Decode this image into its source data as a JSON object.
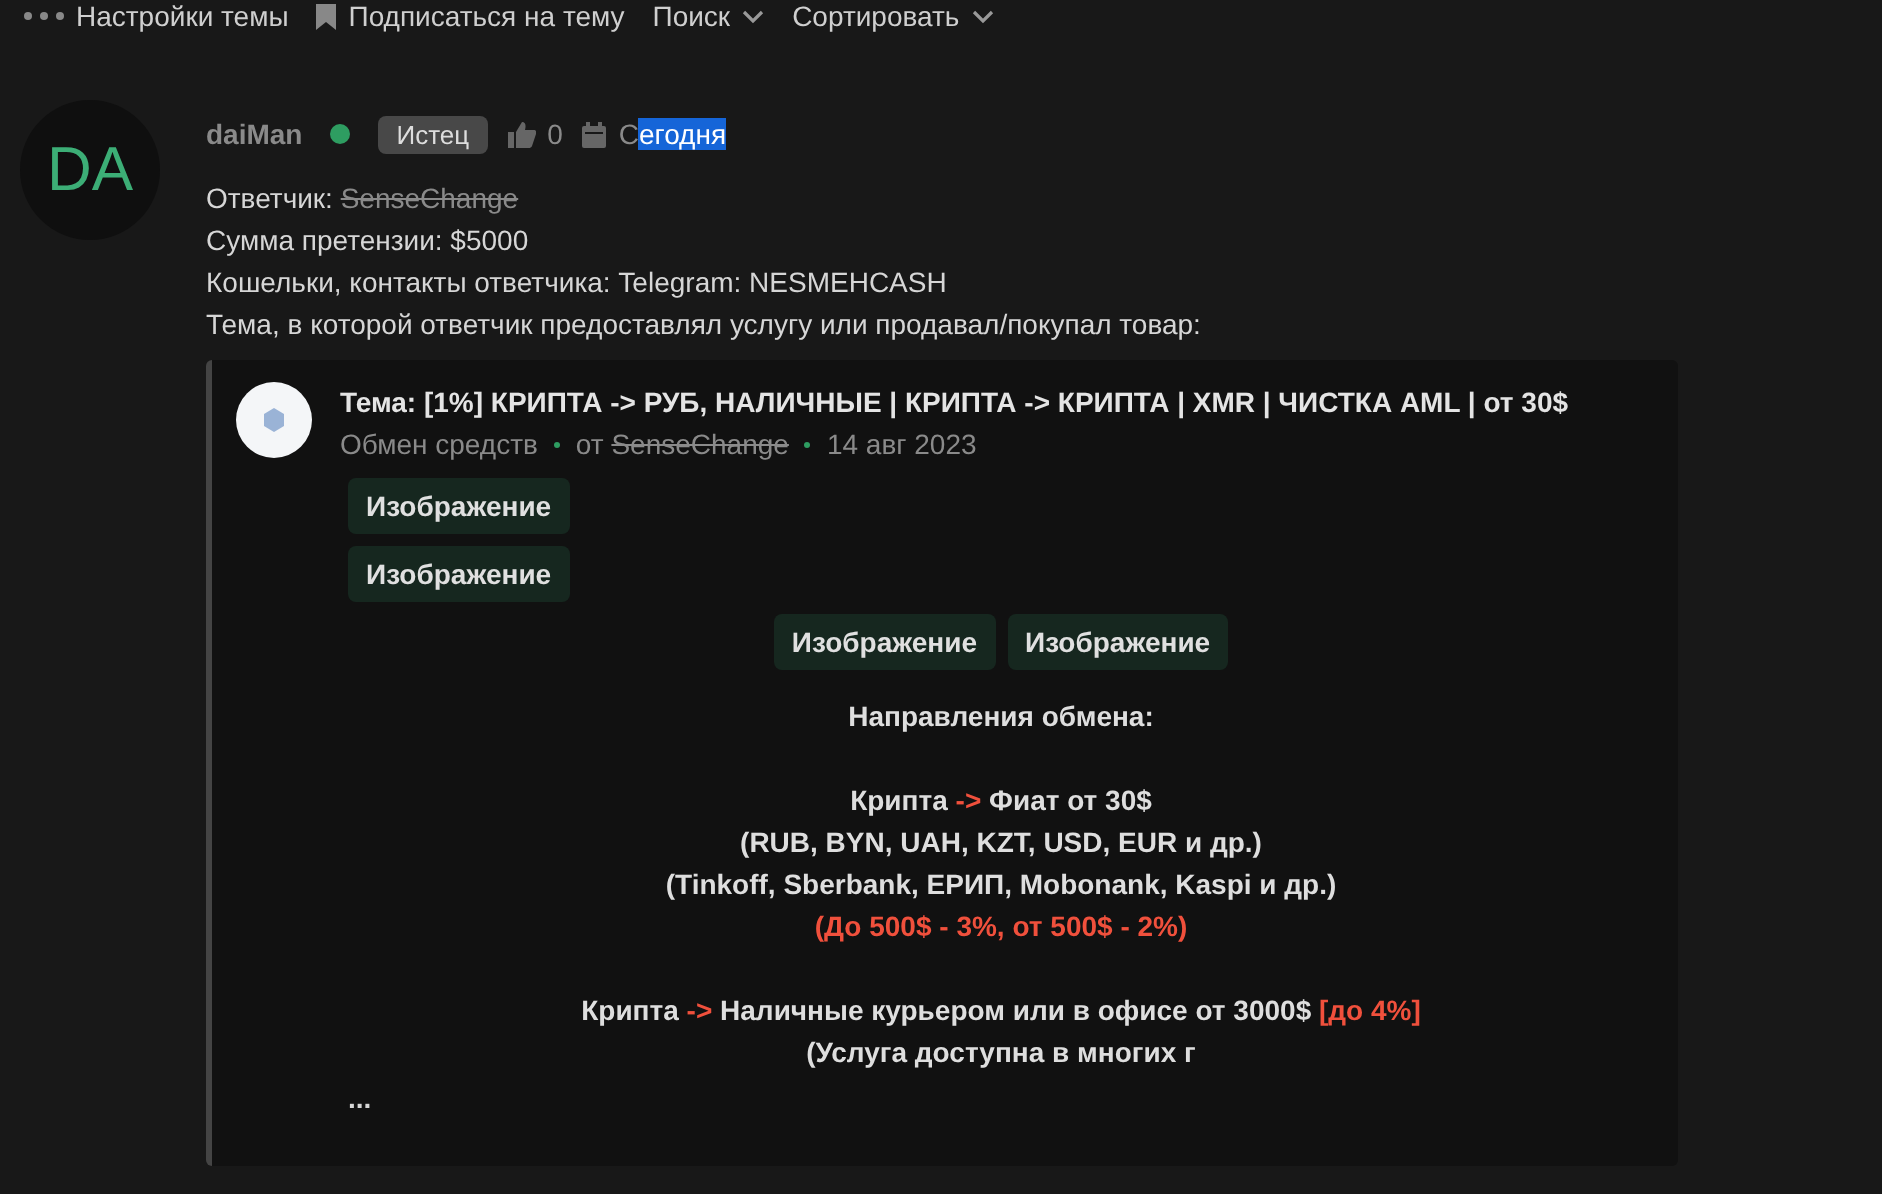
{
  "toolbar": {
    "items": [
      {
        "label": "Настройки темы",
        "kind": "more"
      },
      {
        "label": "Подписаться на тему",
        "kind": "bookmark"
      },
      {
        "label": "Поиск",
        "kind": "dropdown"
      },
      {
        "label": "Сортировать",
        "kind": "dropdown"
      }
    ]
  },
  "post": {
    "avatar": "DA",
    "author": "daiMan",
    "online": true,
    "badge": "Истец",
    "likes": "0",
    "date": [
      {
        "text": "С",
        "selected": false
      },
      {
        "text": "егодня",
        "selected": true
      }
    ],
    "lines": [
      [
        {
          "text": "Ответчик: ",
          "struck": false
        },
        {
          "text": "SenseChange",
          "struck": true
        }
      ],
      [
        {
          "text": "Сумма претензии: $5000",
          "struck": false
        }
      ],
      [
        {
          "text": "Кошельки, контакты ответчика: Telegram: NESMEHCASH",
          "struck": false
        }
      ],
      [
        {
          "text": "Тема, в которой ответчик предоставлял услугу или продавал/покупал товар:",
          "struck": false
        }
      ]
    ],
    "quote": {
      "title": "Тема: [1%] КРИПТА -> РУБ, НАЛИЧНЫЕ | КРИПТА -> КРИПТА | XMR | ЧИСТКА AML | от 30$",
      "section": "Обмен средств",
      "by": "от",
      "seller": "SenseChange",
      "date": "14 авг 2023",
      "image_rows": [
        {
          "centered": false,
          "images": [
            "Изображение"
          ]
        },
        {
          "centered": false,
          "images": [
            "Изображение"
          ]
        },
        {
          "centered": true,
          "images": [
            "Изображение",
            "Изображение"
          ]
        }
      ],
      "paragraphs": [
        [
          [
            {
              "text": "Направления обмена:",
              "accent": false
            }
          ]
        ],
        [
          [
            {
              "text": "Крипта ",
              "accent": false
            },
            {
              "text": "->",
              "accent": true
            },
            {
              "text": " Фиат от 30$",
              "accent": false
            }
          ],
          [
            {
              "text": "(RUB, BYN, UAH, KZT, USD, EUR и др.)",
              "accent": false
            }
          ],
          [
            {
              "text": "(Tinkoff, Sberbank, ЕРИП, Mobonank, Kaspi и др.)",
              "accent": false
            }
          ],
          [
            {
              "text": "(До 500$ - 3%, от 500$ - 2%)",
              "accent": true
            }
          ]
        ],
        [
          [
            {
              "text": "Крипта ",
              "accent": false
            },
            {
              "text": "->",
              "accent": true
            },
            {
              "text": " Наличные курьером или в офисе от 3000$ ",
              "accent": false
            },
            {
              "text": "[до 4%]",
              "accent": true
            }
          ],
          [
            {
              "text": "(Услуга доступна в многих г",
              "accent": false
            }
          ]
        ]
      ],
      "more": "..."
    }
  }
}
